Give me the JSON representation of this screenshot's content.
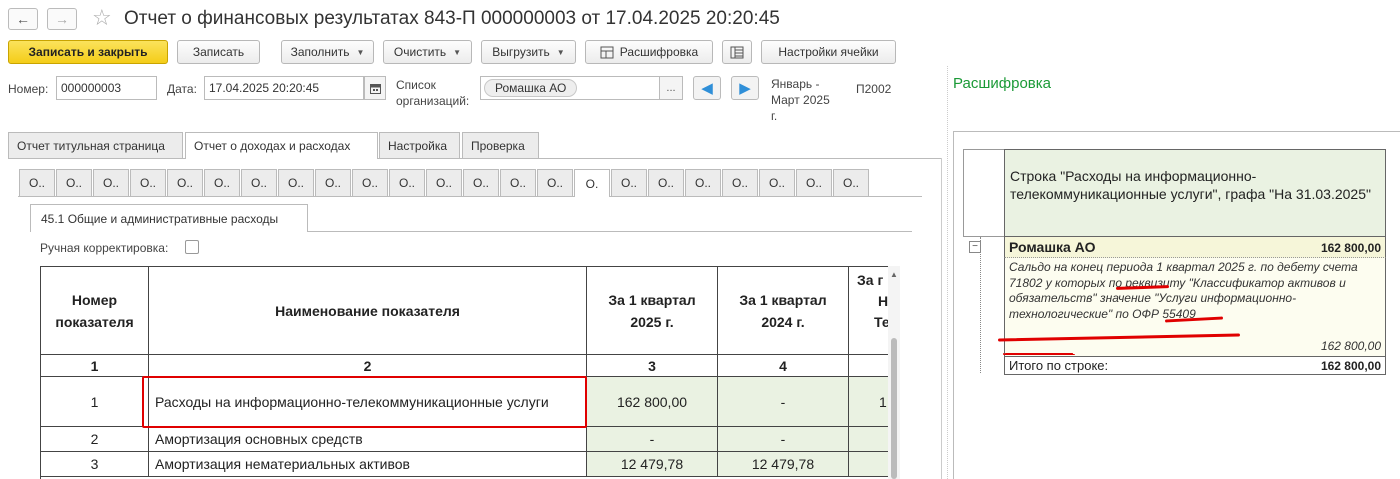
{
  "window": {
    "title": "Отчет о финансовых результатах 843-П 000000003 от 17.04.2025 20:20:45",
    "back_icon": "←",
    "forward_icon": "→",
    "star_icon": "☆"
  },
  "toolbar": {
    "save_close": "Записать и закрыть",
    "save": "Записать",
    "fill": "Заполнить",
    "clear": "Очистить",
    "export": "Выгрузить",
    "decode": "Расшифровка",
    "cell_settings": "Настройки ячейки"
  },
  "header": {
    "number_label": "Номер:",
    "number_value": "000000003",
    "date_label": "Дата:",
    "date_value": "17.04.2025 20:20:45",
    "org_label_line1": "Список",
    "org_label_line2": "организаций:",
    "org_value": "Ромашка АО",
    "org_more": "...",
    "period_line1": "Январь -",
    "period_line2": "Март 2025",
    "period_line3": "г.",
    "code": "П2002"
  },
  "tabs": [
    {
      "label": "Отчет титульная страница"
    },
    {
      "label": "Отчет о доходах и расходах"
    },
    {
      "label": "Настройка"
    },
    {
      "label": "Проверка"
    }
  ],
  "sheet_tabs": [
    "O..",
    "O..",
    "O..",
    "O..",
    "O..",
    "O..",
    "O..",
    "O..",
    "O..",
    "O..",
    "O..",
    "O..",
    "O..",
    "O..",
    "O..",
    "O.",
    "O..",
    "O..",
    "O..",
    "O..",
    "O..",
    "O..",
    "O.."
  ],
  "section": {
    "tab_label": "45.1 Общие и административные расходы",
    "manual_label": "Ручная корректировка:"
  },
  "table": {
    "headers": {
      "num": "Номер показателя",
      "name": "Наименование показателя",
      "q1_2025": "За 1 квартал 2025 г.",
      "q1_2024": "За 1 квартал 2024 г.",
      "extra_1": "За г",
      "extra_2": "Н",
      "extra_3": "Те",
      "extra_4": "г"
    },
    "col_numbers": [
      "1",
      "2",
      "3",
      "4"
    ],
    "rows": [
      {
        "num": "1",
        "name": "Расходы на информационно-телекоммуникационные услуги",
        "q1_2025": "162 800,00",
        "q1_2024": "-",
        "extra": "1"
      },
      {
        "num": "2",
        "name": "Амортизация основных средств",
        "q1_2025": "-",
        "q1_2024": "-",
        "extra": ""
      },
      {
        "num": "3",
        "name": "Амортизация нематериальных активов",
        "q1_2025": "12 479,78",
        "q1_2024": "12 479,78",
        "extra": ""
      }
    ]
  },
  "decoding": {
    "title": "Расшифровка",
    "header": "Строка \"Расходы на информационно-телекоммуникационные услуги\", графа \"На 31.03.2025\"",
    "org_name": "Ромашка АО",
    "org_sum": "162 800,00",
    "description": "Сальдо на конец периода 1 квартал 2025 г. по дебету счета 71802 у которых по реквизиту \"Классификатор активов и обязательств\" значение \"Услуги информационно-технологические\" по ОФР 55409",
    "desc_sum": "162 800,00",
    "total_label": "Итого по строке:",
    "total_sum": "162 800,00",
    "tree_toggle": "−"
  },
  "colors": {
    "primary_button": "#f4cd18",
    "highlight_red": "#e00000",
    "green_cell": "#eaf2e2",
    "section_title_green": "#1b9a37",
    "nav_arrow_blue": "#2f8fd8"
  }
}
